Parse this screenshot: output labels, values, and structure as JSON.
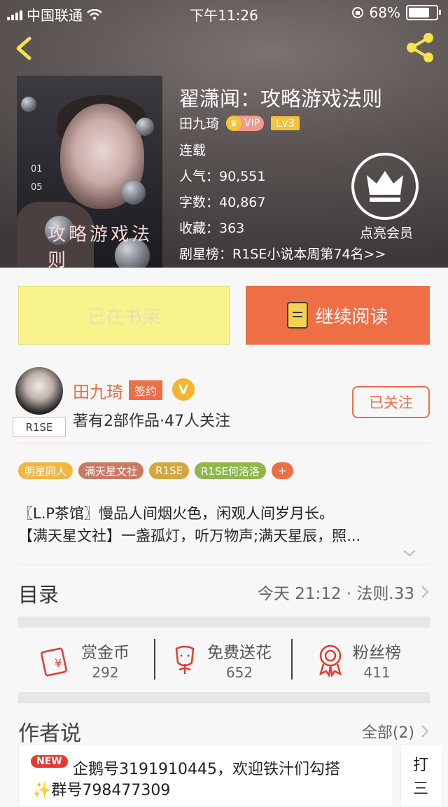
{
  "status_bar": {
    "carrier": "中国联通",
    "time": "下午11:26",
    "battery": "68%",
    "battery_level": 0.68
  },
  "book": {
    "title": "翟潇闻：攻略游戏法则",
    "author": "田九琦",
    "vip_label": "VIP",
    "level": "Lv3",
    "state": "连载",
    "popularity": "人气：90,551",
    "words": "字数：40,867",
    "favorites": "收藏：363",
    "ranking": "剧星榜：R1SE小说本周第74名>>",
    "member_label": "点亮会员",
    "cover_text": "攻略游戏法则",
    "cover_numbers": [
      "01",
      "05"
    ]
  },
  "actions": {
    "shelf": "已在书架",
    "read": "继续阅读"
  },
  "author_card": {
    "name": "田九琦",
    "signed": "签约",
    "v": "V",
    "stats": "著有2部作品·47人关注",
    "follow": "已关注",
    "avatar_tag": "R1SE"
  },
  "tags": [
    {
      "label": "明星同人",
      "color": "#f2b740"
    },
    {
      "label": "满天星文社",
      "color": "#c97a65"
    },
    {
      "label": "R1SE",
      "color": "#d4a640"
    },
    {
      "label": "R1SE何洛洛",
      "color": "#8db84a"
    },
    {
      "label": "+",
      "color": "#ee6e45"
    }
  ],
  "description": {
    "line1": "〖L.P茶馆〗慢品人间烟火色，闲观人间岁月长。",
    "line2": "【满天星文社】一盏孤灯，听万物声;满天星辰，照..."
  },
  "toc": {
    "title": "目录",
    "latest": "今天 21:12 · 法则.33"
  },
  "stats": [
    {
      "label": "赏金币",
      "value": "292",
      "icon": "reward-coin-icon"
    },
    {
      "label": "免费送花",
      "value": "652",
      "icon": "flower-icon"
    },
    {
      "label": "粉丝榜",
      "value": "411",
      "icon": "fan-rank-icon"
    }
  ],
  "author_says": {
    "title": "作者说",
    "all": "全部(2)",
    "new_badge": "NEW",
    "line1": "企鹅号3191910445，欢迎铁汁们勾搭",
    "line2": "✨群号798477309",
    "side_line1": "打",
    "side_line2": "三"
  }
}
